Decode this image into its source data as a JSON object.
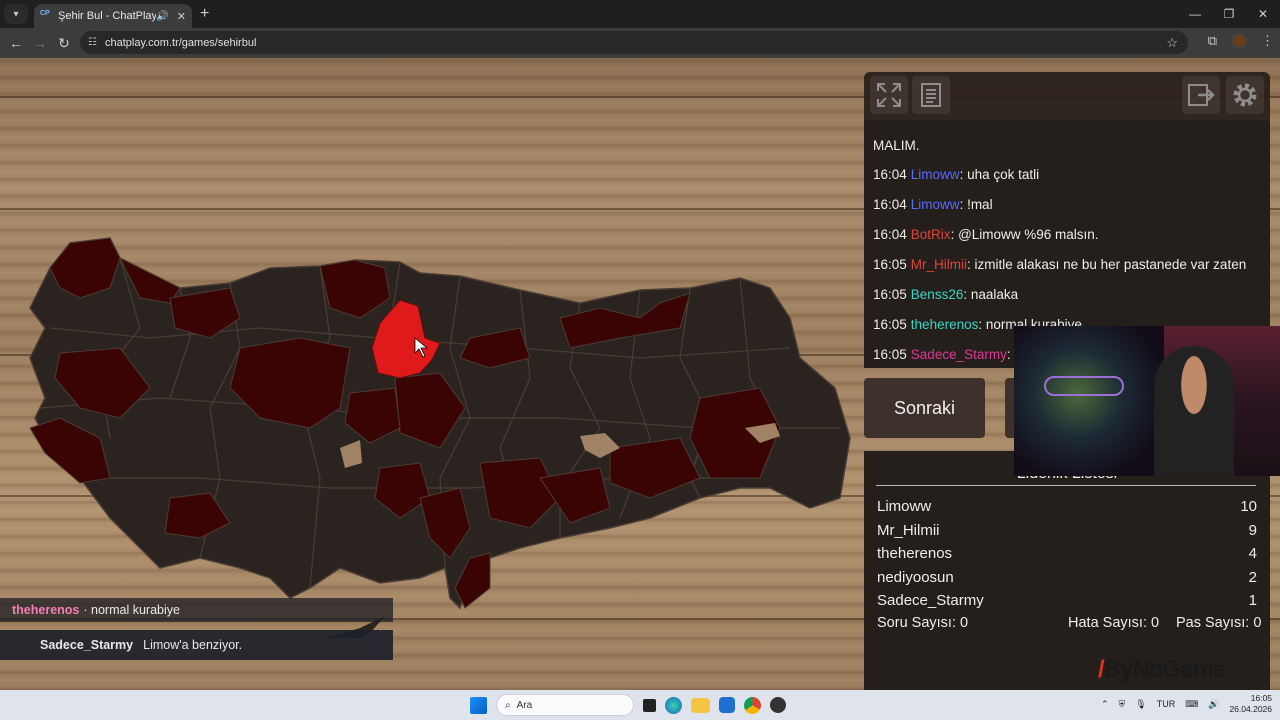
{
  "browser": {
    "tab_title": "Şehir Bul - ChatPlay",
    "tab_favicon": "CP",
    "url": "chatplay.com.tr/games/sehirbul"
  },
  "chat": {
    "partial_top": "MALIM.",
    "messages": [
      {
        "time": "16:04",
        "user": "Limoww",
        "color": "#5a6bff",
        "text": ": uha çok tatli"
      },
      {
        "time": "16:04",
        "user": "Limoww",
        "color": "#5a6bff",
        "text": ": !mal"
      },
      {
        "time": "16:04",
        "user": "BotRix",
        "color": "#e0423a",
        "text": ": @Limoww %96 malsın."
      },
      {
        "time": "16:05",
        "user": "Mr_Hilmii",
        "color": "#e0423a",
        "text": ": izmitle alakası ne bu her pastanede var zaten"
      },
      {
        "time": "16:05",
        "user": "Benss26",
        "color": "#35d6c5",
        "text": ": naalaka"
      },
      {
        "time": "16:05",
        "user": "theherenos",
        "color": "#35d6c5",
        "text": ": normal kurabiye"
      },
      {
        "time": "16:05",
        "user": "Sadece_Starmy",
        "color": "#e2369a",
        "text": ": L"
      }
    ]
  },
  "buttons": {
    "next": "Sonraki"
  },
  "leaderboard": {
    "title": "Liderlik Listesi",
    "rows": [
      {
        "name": "Limoww",
        "score": "10"
      },
      {
        "name": "Mr_Hilmii",
        "score": "9"
      },
      {
        "name": "theherenos",
        "score": "4"
      },
      {
        "name": "nediyoosun",
        "score": "2"
      },
      {
        "name": "Sadece_Starmy",
        "score": "1"
      }
    ],
    "stats": {
      "questions": "Soru Sayısı: 0",
      "errors": "Hata Sayısı: 0",
      "passes": "Pas Sayısı: 0"
    }
  },
  "overlay": {
    "toast1_user": "theherenos",
    "toast1_text": "· normal kurabiye",
    "toast2_user": "Sadece_Starmy",
    "toast2_text": "Limow'a benziyor.",
    "logo": "ByNoGame"
  },
  "taskbar": {
    "search_placeholder": "Ara",
    "lang": "TUR",
    "time": "16:05",
    "date": "26.04.2026"
  },
  "colors": {
    "selected_city": "#e0191b",
    "guessed_city": "#3b0404",
    "land": "#2b2320"
  }
}
